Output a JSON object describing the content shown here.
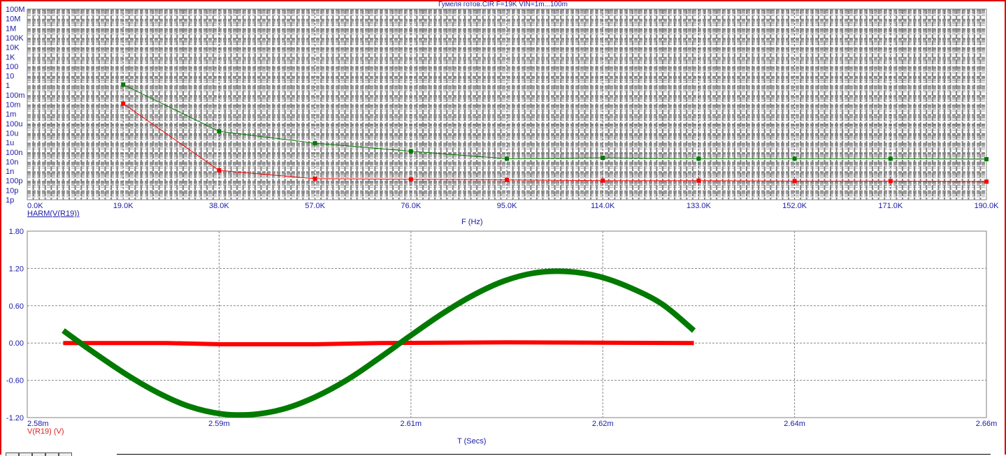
{
  "window": {
    "title": "Гумеля готов.CIR F=19K VIN=1m...100m"
  },
  "colors": {
    "axis_text": "#1a1aa6",
    "series_green": "#007a00",
    "series_red": "#ff0000",
    "grid": "#808080",
    "border": "#e00000"
  },
  "chart_data": [
    {
      "type": "line",
      "title": "Гумеля готов.CIR F=19K VIN=1m...100m",
      "xlabel": "F (Hz)",
      "legend": "HARM(V(R19))",
      "yscale": "log",
      "ylim": [
        1e-12,
        100000000.0
      ],
      "xlim": [
        0,
        190000
      ],
      "grid": true,
      "x_tick_labels": [
        "0.0K",
        "19.0K",
        "38.0K",
        "57.0K",
        "76.0K",
        "95.0K",
        "114.0K",
        "133.0K",
        "152.0K",
        "171.0K",
        "190.0K"
      ],
      "y_tick_labels": [
        "100M",
        "10M",
        "1M",
        "100K",
        "10K",
        "1K",
        "100",
        "10",
        "1",
        "100m",
        "10m",
        "1m",
        "100u",
        "10u",
        "1u",
        "100n",
        "10n",
        "1n",
        "100p",
        "10p",
        "1p"
      ],
      "x": [
        19000,
        38000,
        57000,
        76000,
        95000,
        114000,
        133000,
        152000,
        171000,
        190000
      ],
      "series": [
        {
          "name": "green",
          "values": [
            1.2,
            1.5e-05,
            8.5e-07,
            1.2e-07,
            2e-08,
            2.5e-08,
            2e-08,
            2e-08,
            2e-08,
            1.8e-08
          ]
        },
        {
          "name": "red",
          "values": [
            0.012,
            1.2e-09,
            1.6e-10,
            1.4e-10,
            1.2e-10,
            1e-10,
            1e-10,
            9e-11,
            9e-11,
            8e-11
          ]
        }
      ]
    },
    {
      "type": "line",
      "xlabel": "T (Secs)",
      "legend": "V(R19) (V)",
      "xlim": [
        2.58,
        2.66
      ],
      "ylim": [
        -1.2,
        1.8
      ],
      "grid": true,
      "x_tick_labels": [
        "2.58m",
        "2.59m",
        "2.61m",
        "2.62m",
        "2.64m",
        "2.66m"
      ],
      "y_tick_labels": [
        "1.80",
        "1.20",
        "0.60",
        "0.00",
        "-0.60",
        "-1.20"
      ],
      "y_ticks": [
        1.8,
        1.2,
        0.6,
        0.0,
        -0.6,
        -1.2
      ],
      "series": [
        {
          "name": "green",
          "t_ms": [
            2.583,
            2.5856,
            2.5883,
            2.5909,
            2.5935,
            2.5962,
            2.5988,
            2.6014,
            2.604,
            2.6067,
            2.6093,
            2.6119,
            2.6146,
            2.6172,
            2.6198,
            2.6224,
            2.6251,
            2.6277,
            2.6303,
            2.633,
            2.6356
          ],
          "values": [
            0.2,
            -0.16,
            -0.51,
            -0.8,
            -1.02,
            -1.14,
            -1.15,
            -1.06,
            -0.87,
            -0.59,
            -0.25,
            0.11,
            0.47,
            0.77,
            1.0,
            1.13,
            1.15,
            1.07,
            0.89,
            0.62,
            0.2
          ]
        },
        {
          "name": "red",
          "t_ms": [
            2.583,
            2.5916,
            2.5962,
            2.604,
            2.6093,
            2.62,
            2.6356
          ],
          "values": [
            0.0,
            0.0,
            -0.02,
            -0.02,
            0.0,
            0.01,
            0.0
          ]
        }
      ]
    }
  ]
}
